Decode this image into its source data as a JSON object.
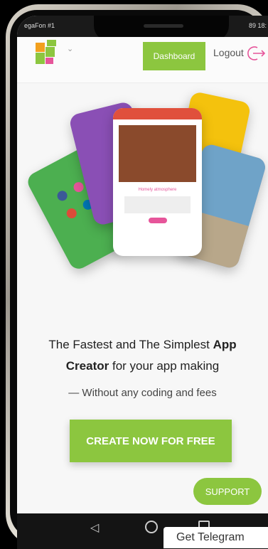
{
  "status": {
    "carrier": "egaFon #1",
    "right": "89 18:"
  },
  "header": {
    "dashboard_label": "Dashboard",
    "logout_label": "Logout"
  },
  "hero": {
    "headline_prefix": "The Fastest and The Simplest ",
    "headline_bold1": "App",
    "headline_bold2": "Creator",
    "headline_suffix": " for your app making",
    "subline": "— Without any coding and fees",
    "cta_label": "CREATE NOW FOR FREE",
    "mock_card_title": "Homely atmosphere"
  },
  "support_label": "SUPPORT",
  "telegram_label": "Get Telegram",
  "colors": {
    "accent": "#8cc63f",
    "logo_orange": "#f2a01e",
    "logo_pink": "#e6559a"
  }
}
